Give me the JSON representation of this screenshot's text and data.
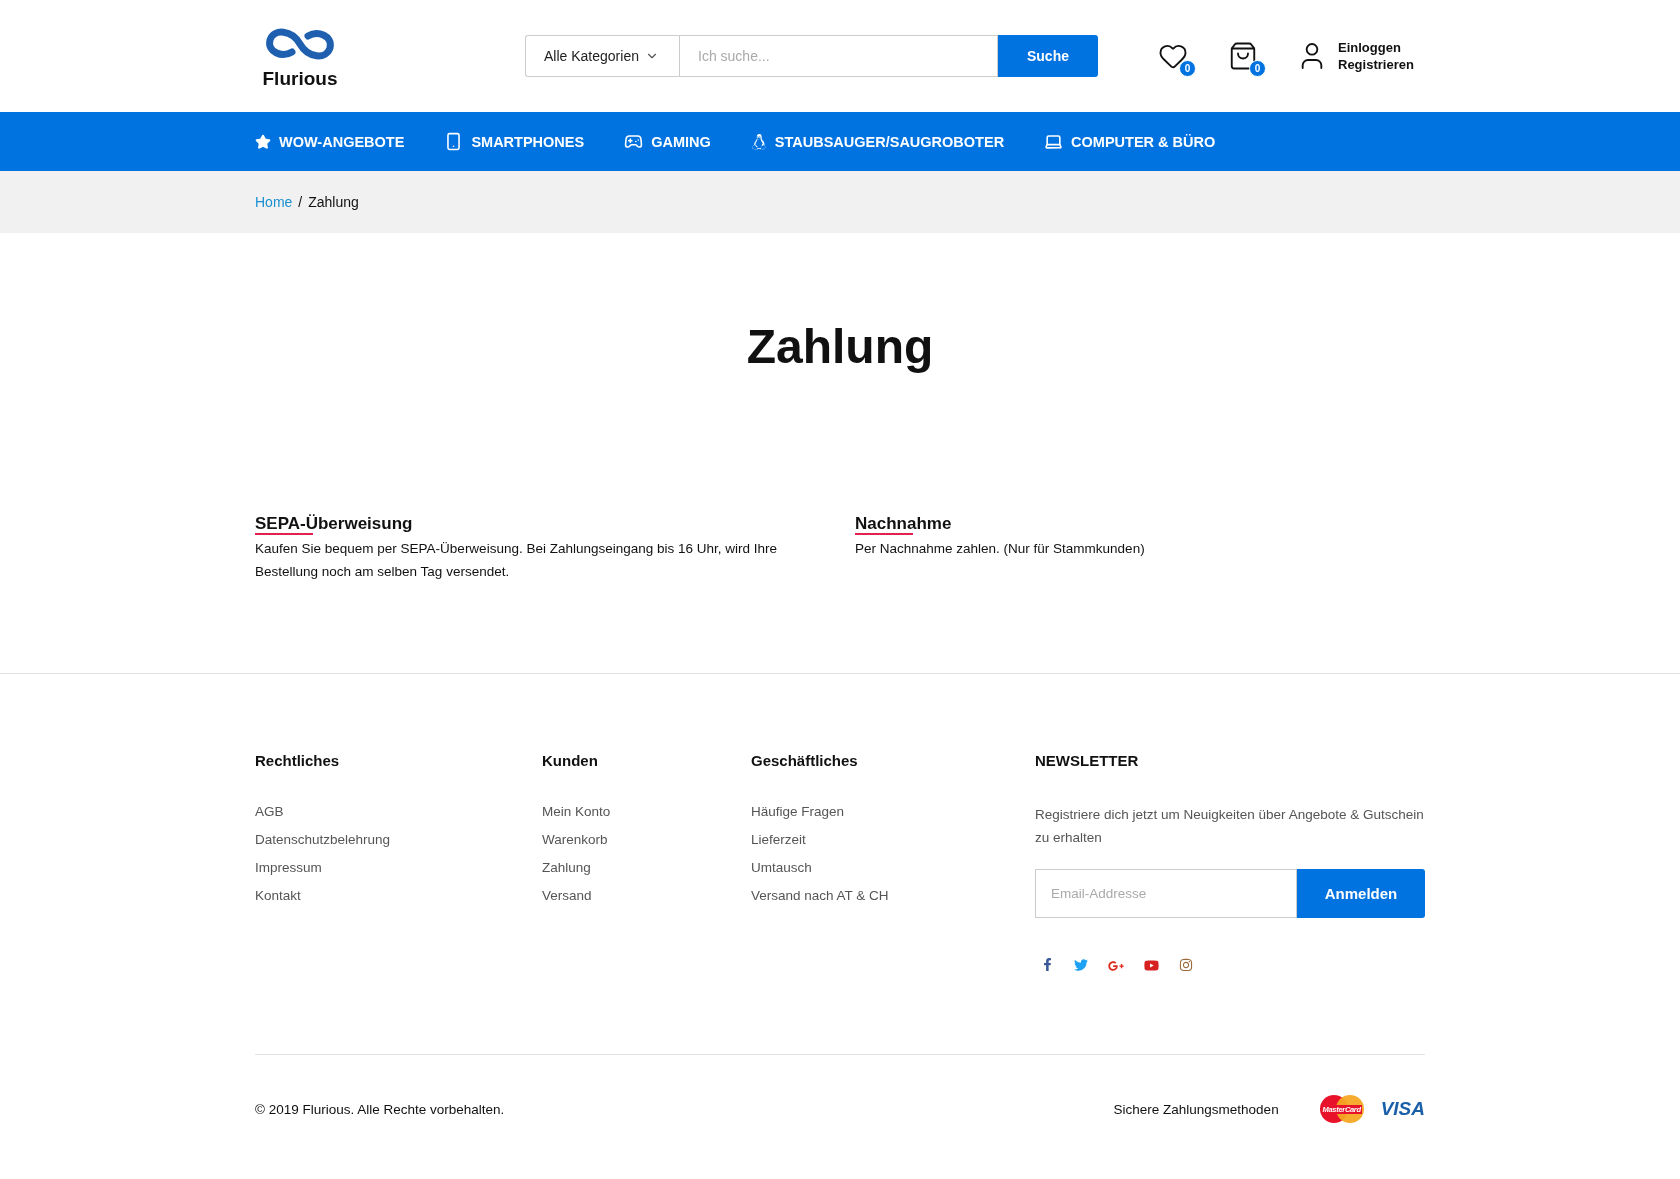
{
  "header": {
    "logo": "Flurious",
    "search": {
      "category": "Alle Kategorien",
      "placeholder": "Ich suche...",
      "button": "Suche"
    },
    "wishlist_count": "0",
    "cart_count": "0",
    "account": {
      "login": "Einloggen",
      "register": "Registrieren"
    }
  },
  "nav": [
    {
      "kind": "star",
      "label": "WOW-ANGEBOTE"
    },
    {
      "kind": "phone",
      "label": "SMARTPHONES"
    },
    {
      "kind": "gamepad",
      "label": "GAMING"
    },
    {
      "kind": "penguin",
      "label": "STAUBSAUGER/SAUGROBOTER"
    },
    {
      "kind": "laptop",
      "label": "COMPUTER & BÜRO"
    }
  ],
  "breadcrumb": [
    {
      "kind": "link",
      "label": "Home"
    },
    {
      "kind": "separator",
      "label": "/"
    },
    {
      "kind": "current",
      "label": "Zahlung"
    }
  ],
  "page_title": "Zahlung",
  "payment_methods": [
    {
      "title": "SEPA-Überweisung",
      "text": "Kaufen Sie bequem per SEPA-Überweisung. Bei Zahlungseingang bis 16 Uhr, wird Ihre Bestellung noch am selben Tag versendet."
    },
    {
      "title": "Nachnahme",
      "text": "Per Nachnahme zahlen. (Nur für Stammkunden)"
    }
  ],
  "footer": {
    "columns": [
      {
        "title": "Rechtliches",
        "links": [
          "AGB",
          "Datenschutzbelehrung",
          "Impressum",
          "Kontakt"
        ]
      },
      {
        "title": "Kunden",
        "links": [
          "Mein Konto",
          "Warenkorb",
          "Zahlung",
          "Versand"
        ]
      },
      {
        "title": "Geschäftliches",
        "links": [
          "Häufige Fragen",
          "Lieferzeit",
          "Umtausch",
          "Versand nach AT & CH"
        ]
      }
    ],
    "newsletter": {
      "title": "NEWSLETTER",
      "text": "Registriere dich jetzt um Neuigkeiten über Angebote & Gutschein zu erhalten",
      "placeholder": "Email-Addresse",
      "button": "Anmelden"
    },
    "social": [
      {
        "kind": "facebook"
      },
      {
        "kind": "twitter"
      },
      {
        "kind": "googleplus"
      },
      {
        "kind": "youtube"
      },
      {
        "kind": "instagram"
      }
    ],
    "copyright": "© 2019 Flurious. Alle Rechte vorbehalten.",
    "secure_label": "Sichere Zahlungsmethoden",
    "card_logos": [
      {
        "kind": "mastercard",
        "text": "MasterCard"
      },
      {
        "kind": "visa",
        "text": "VISA"
      }
    ]
  }
}
